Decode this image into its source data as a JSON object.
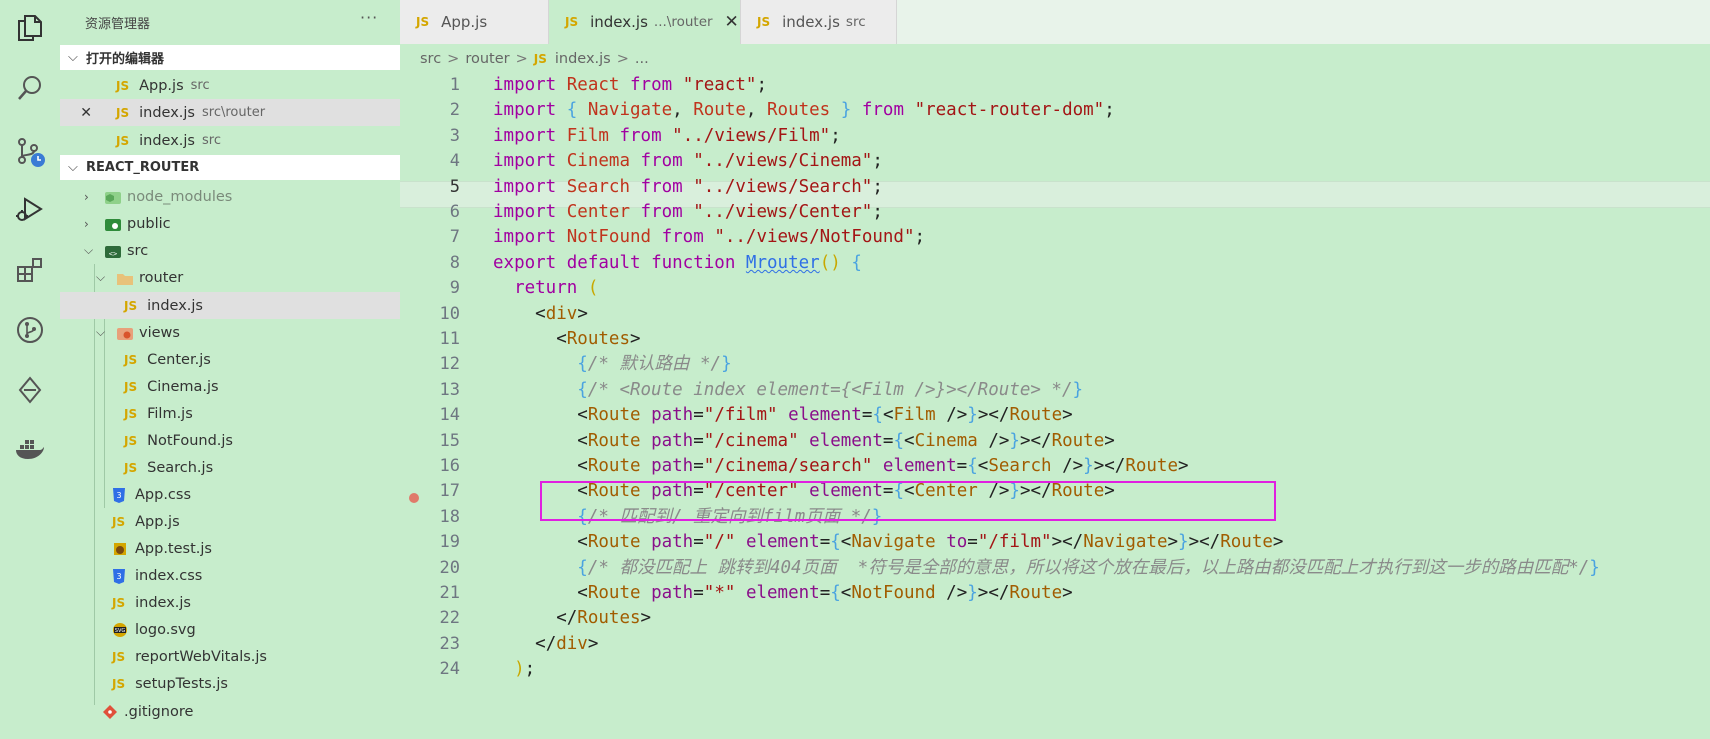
{
  "sidebar": {
    "title": "资源管理器",
    "more": "···",
    "open_editors_header": "打开的编辑器",
    "open_editors": [
      {
        "name": "App.js",
        "desc": "src"
      },
      {
        "name": "index.js",
        "desc": "src\\router",
        "close": "✕"
      },
      {
        "name": "index.js",
        "desc": "src"
      }
    ],
    "project_header": "REACT_ROUTER",
    "tree": [
      {
        "name": "node_modules"
      },
      {
        "name": "public"
      },
      {
        "name": "src"
      },
      {
        "name": "router"
      },
      {
        "name": "index.js"
      },
      {
        "name": "views"
      },
      {
        "name": "Center.js"
      },
      {
        "name": "Cinema.js"
      },
      {
        "name": "Film.js"
      },
      {
        "name": "NotFound.js"
      },
      {
        "name": "Search.js"
      },
      {
        "name": "App.css"
      },
      {
        "name": "App.js"
      },
      {
        "name": "App.test.js"
      },
      {
        "name": "index.css"
      },
      {
        "name": "index.js"
      },
      {
        "name": "logo.svg"
      },
      {
        "name": "reportWebVitals.js"
      },
      {
        "name": "setupTests.js"
      },
      {
        "name": ".gitignore"
      }
    ]
  },
  "tabs": [
    {
      "name": "App.js",
      "desc": ""
    },
    {
      "name": "index.js",
      "desc": "...\\router",
      "close": "✕"
    },
    {
      "name": "index.js",
      "desc": "src"
    }
  ],
  "js_badge": "JS",
  "breadcrumb": {
    "parts": [
      "src",
      "router",
      "index.js",
      "..."
    ],
    "sep": ">"
  },
  "editor": {
    "line_numbers": [
      "1",
      "2",
      "3",
      "4",
      "5",
      "6",
      "7",
      "8",
      "9",
      "10",
      "11",
      "12",
      "13",
      "14",
      "15",
      "16",
      "17",
      "18",
      "19",
      "20",
      "21",
      "22",
      "23",
      "24"
    ],
    "lines": [
      "import React from \"react\";",
      "import { Navigate, Route, Routes } from \"react-router-dom\";",
      "import Film from \"../views/Film\";",
      "import Cinema from \"../views/Cinema\";",
      "import Search from \"../views/Search\";",
      "import Center from \"../views/Center\";",
      "import NotFound from \"../views/NotFound\";",
      "export default function Mrouter() {",
      "  return (",
      "    <div>",
      "      <Routes>",
      "        {/* 默认路由 */}",
      "        {/* <Route index element={<Film />}></Route> */}",
      "        <Route path=\"/film\" element={<Film />}></Route>",
      "        <Route path=\"/cinema\" element={<Cinema />}></Route>",
      "        <Route path=\"/cinema/search\" element={<Search />}></Route>",
      "        <Route path=\"/center\" element={<Center />}></Route>",
      "        {/* 匹配到/ 重定向到film页面 */}",
      "        <Route path=\"/\" element={<Navigate to=\"/film\"></Navigate>}></Route>",
      "        {/* 都没匹配上 跳转到404页面  *符号是全部的意思，所以将这个放在最后，以上路由都没匹配上才执行到这一步的路由匹配*/}",
      "        <Route path=\"*\" element={<NotFound />}></Route>",
      "      </Routes>",
      "    </div>",
      "  );"
    ]
  },
  "colors": {
    "background": "#c7edcc",
    "highlight_box": "#e020e0",
    "js_badge": "#d4a600"
  }
}
